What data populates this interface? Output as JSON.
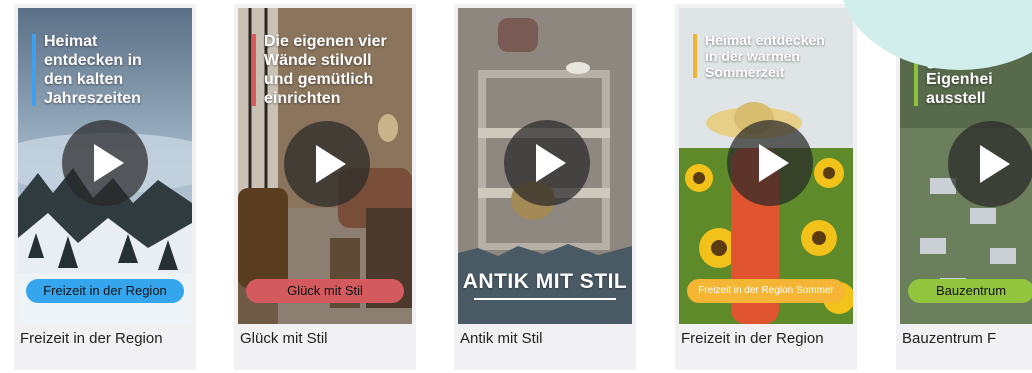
{
  "cards": [
    {
      "headline": "Heimat\nentdecken in\nden kalten\nJahreszeiten",
      "pill": "Freizeit in der Region",
      "caption": "Freizeit in der Region",
      "accent": "#3fa0f0",
      "pill_bg": "#35a6ee",
      "icon": "play-icon"
    },
    {
      "headline": "Die eigenen vier\nWände stilvoll\nund gemütlich\neinrichten",
      "pill": "Glück mit Stil",
      "caption": "Glück mit Stil",
      "accent": "#d65a5e",
      "pill_bg": "#d35b60",
      "icon": "play-icon"
    },
    {
      "headline": "",
      "overlay_label": "ANTIK MIT STIL",
      "caption": "Antik mit Stil",
      "icon": "play-icon"
    },
    {
      "headline": "Heimat entdecken\nin der warmen\nSommerzeit",
      "pill": "Freizeit in der Region Sommer",
      "caption": "Freizeit in der Region",
      "accent": "#f2b233",
      "pill_bg": "#f4b634",
      "icon": "play-icon"
    },
    {
      "headline": "Bayerns\ngrößte\nEigenhei\nausstell",
      "pill": "Bauzentrum",
      "caption": "Bauzentrum F",
      "accent": "#8fc23c",
      "pill_bg": "#93c43e",
      "icon": "play-icon"
    }
  ],
  "decoration_color": "#d2eeec"
}
